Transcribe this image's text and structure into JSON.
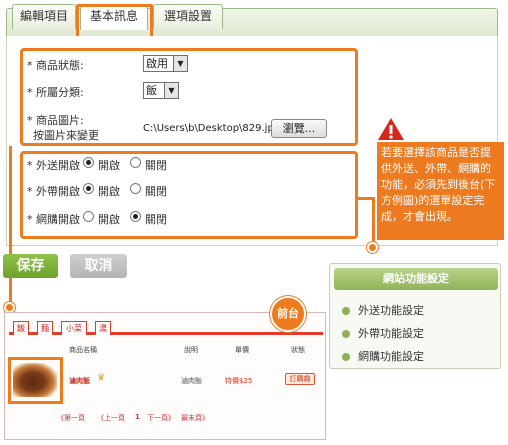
{
  "tabs": [
    {
      "label": "編輯項目"
    },
    {
      "label": "基本訊息"
    },
    {
      "label": "選項設置"
    }
  ],
  "form": {
    "status_label": "* 商品狀態:",
    "status_value": "啟用",
    "category_label": "* 所屬分類:",
    "category_value": "飯",
    "image_label": "* 商品圖片:",
    "image_sublabel": "按圖片來變更",
    "image_path": "C:\\Users\\b\\Desktop\\829.jpg",
    "browse_label": "瀏覽...",
    "toggles": [
      {
        "label": "* 外送開啟",
        "on": "開啟",
        "off": "關閉",
        "selected": "on"
      },
      {
        "label": "* 外帶開啟",
        "on": "開啟",
        "off": "關閉",
        "selected": "on"
      },
      {
        "label": "* 網購開啟",
        "on": "開啟",
        "off": "關閉",
        "selected": "off"
      }
    ]
  },
  "note": {
    "text": "若要選擇該商品是否提供外送、外帶、網購的功能，必須先到後台(下方例圖)的選單設定完成，才會出現。",
    "icon": "warning-icon"
  },
  "buttons": {
    "save": "保存",
    "cancel": "取消",
    "save_color": "#7fb33a",
    "cancel_color": "#c3c3c3"
  },
  "func_panel": {
    "title": "網站功能設定",
    "items": [
      "外送功能設定",
      "外帶功能設定",
      "網購功能設定"
    ]
  },
  "front": {
    "badge": "前台"
  },
  "shop": {
    "tabs": [
      "飯",
      "麵",
      "小菜",
      "湯"
    ],
    "headers": [
      "商品名稱",
      "說明",
      "單價",
      "狀態"
    ],
    "product": {
      "name": "滷肉飯",
      "desc": "滷肉飯",
      "price": "特價$25",
      "action": "訂購趣"
    },
    "pager": {
      "first": "《第一頁",
      "prev": "《上一頁",
      "page": "1",
      "next": "下一頁》",
      "last": "最末頁》"
    }
  },
  "accent": "#ef7b1f"
}
